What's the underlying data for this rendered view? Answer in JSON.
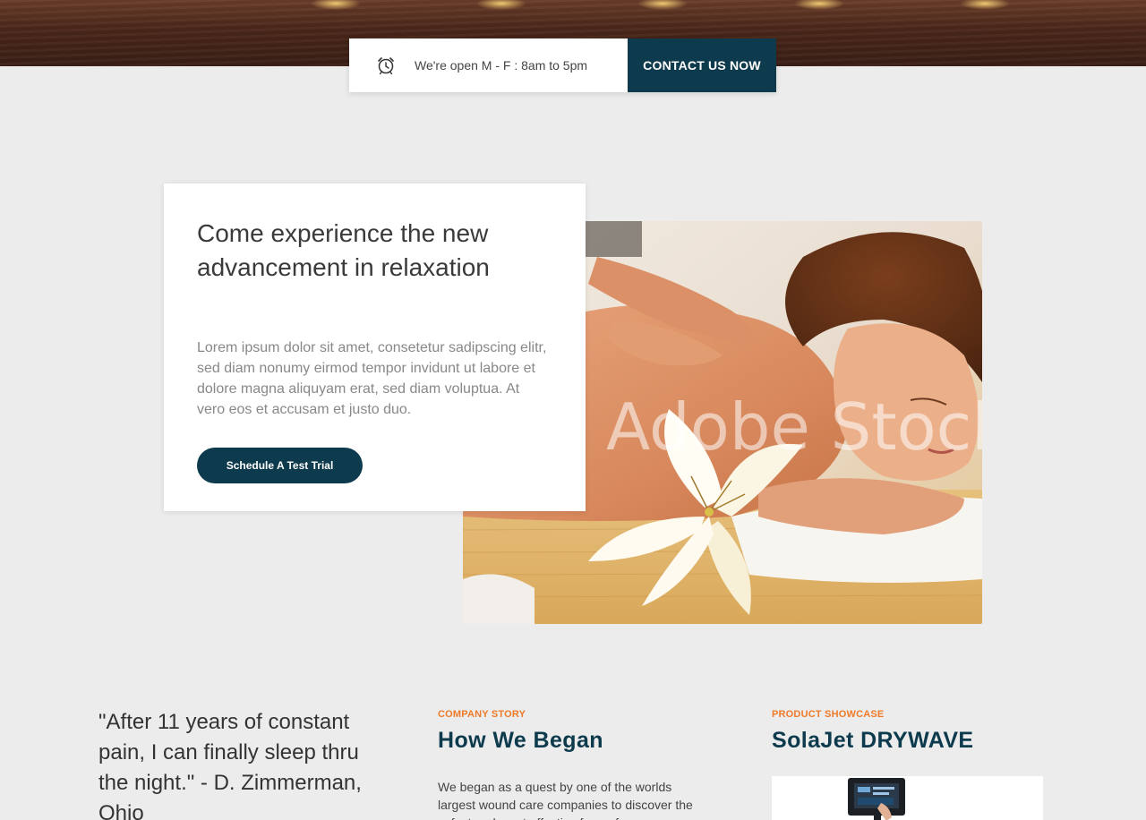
{
  "hours_bar": {
    "icon": "alarm-clock-icon",
    "hours_text": "We're open M - F : 8am to 5pm",
    "contact_label": "CONTACT US NOW"
  },
  "feature": {
    "title": "Come experience the new advancement in relaxation",
    "body": "Lorem ipsum dolor sit amet, consetetur sadipscing elitr, sed diam nonumy eirmod tempor invidunt ut labore et dolore magna aliquyam erat, sed diam voluptua. At vero eos et accusam et justo duo.",
    "cta_label": "Schedule A Test Trial",
    "image_watermark": "Adobe Stock"
  },
  "testimonial": {
    "quote": "\"After 11 years of constant pain, I can finally sleep thru the night.\" - D. Zimmerman, Ohio"
  },
  "company_story": {
    "eyebrow": "COMPANY STORY",
    "title": "How We Began",
    "body": "We began as a quest by one of the worlds largest wound care companies to discover the safest and most effective form of"
  },
  "product_showcase": {
    "eyebrow": "PRODUCT SHOWCASE",
    "title": "SolaJet DRYWAVE"
  },
  "colors": {
    "brand_dark": "#0d3a4c",
    "accent_orange": "#ef7a2a",
    "page_bg": "#ececec"
  }
}
